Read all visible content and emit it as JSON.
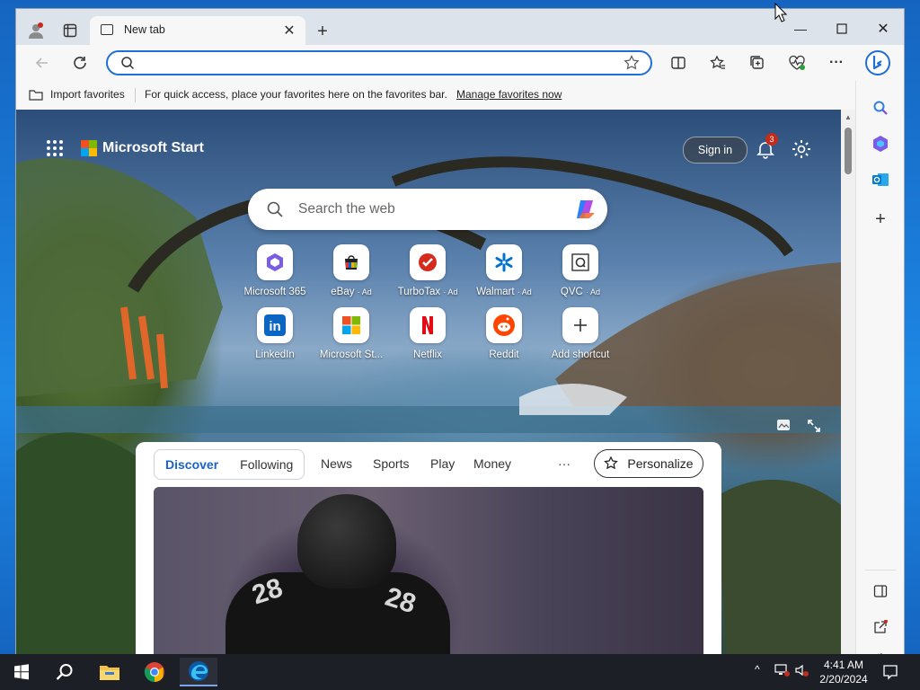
{
  "browser": {
    "tab_title": "New tab",
    "address_value": "",
    "favorites_bar": {
      "import_label": "Import favorites",
      "message": "For quick access, place your favorites here on the favorites bar.",
      "manage_link": "Manage favorites now"
    }
  },
  "newtab": {
    "brand": "Microsoft Start",
    "signin_label": "Sign in",
    "notification_count": "3",
    "search_placeholder": "Search the web",
    "shortcuts": [
      {
        "label": "Microsoft 365",
        "ad": "",
        "icon": "microsoft-365-icon"
      },
      {
        "label": "eBay",
        "ad": "· Ad",
        "icon": "ebay-icon"
      },
      {
        "label": "TurboTax",
        "ad": "· Ad",
        "icon": "turbotax-icon"
      },
      {
        "label": "Walmart",
        "ad": "· Ad",
        "icon": "walmart-icon"
      },
      {
        "label": "QVC",
        "ad": "· Ad",
        "icon": "qvc-icon"
      },
      {
        "label": "LinkedIn",
        "ad": "",
        "icon": "linkedin-icon"
      },
      {
        "label": "Microsoft St...",
        "ad": "",
        "icon": "microsoft-store-icon"
      },
      {
        "label": "Netflix",
        "ad": "",
        "icon": "netflix-icon"
      },
      {
        "label": "Reddit",
        "ad": "",
        "icon": "reddit-icon"
      },
      {
        "label": "Add shortcut",
        "ad": "",
        "icon": "plus-icon"
      }
    ],
    "feed": {
      "tabs": [
        "Discover",
        "Following"
      ],
      "categories": [
        "News",
        "Sports",
        "Play",
        "Money"
      ],
      "more": "···",
      "personalize_label": "Personalize",
      "hero_jersey_number": "28"
    }
  },
  "taskbar": {
    "time": "4:41 AM",
    "date": "2/20/2024"
  },
  "colors": {
    "accent": "#1f6fd6",
    "link": "#1b62c9",
    "taskbar": "#1d1f27"
  }
}
